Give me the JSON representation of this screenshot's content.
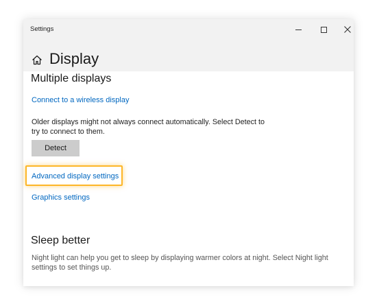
{
  "window": {
    "app_title": "Settings",
    "controls": {
      "minimize": "minimize-icon",
      "maximize": "maximize-icon",
      "close": "close-icon"
    }
  },
  "header": {
    "icon": "home-icon",
    "title": "Display"
  },
  "multiple_displays": {
    "heading": "Multiple displays",
    "wireless_link": "Connect to a wireless display",
    "description_line1": "Older displays might not always connect automatically. Select Detect to",
    "description_line2": "try to connect to them.",
    "detect_button": "Detect",
    "advanced_link": "Advanced display settings",
    "graphics_link": "Graphics settings"
  },
  "sleep_better": {
    "heading": "Sleep better",
    "description_line1": "Night light can help you get to sleep by displaying warmer colors at night. Select Night light",
    "description_line2": "settings to set things up."
  },
  "colors": {
    "link": "#0067c0",
    "highlight": "#fdb627",
    "button_bg": "#cccccc",
    "titlebar_bg": "#f2f2f2"
  }
}
